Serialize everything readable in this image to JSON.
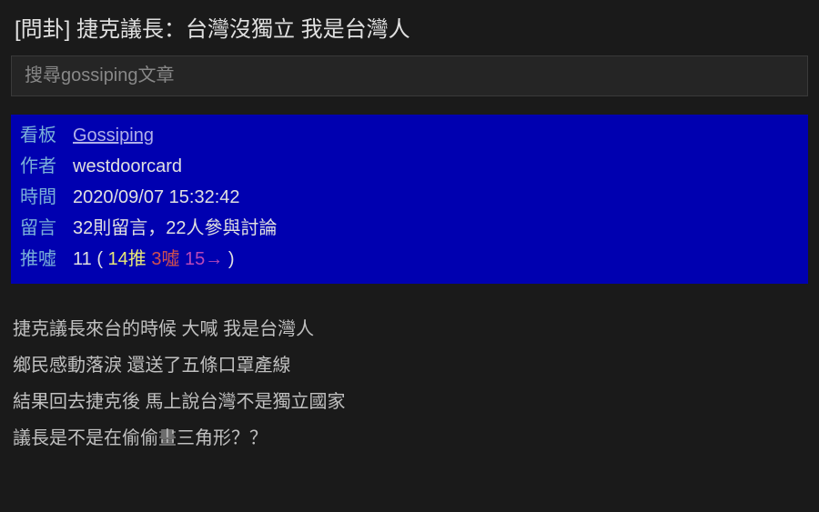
{
  "header": {
    "title": "[問卦] 捷克議長：台灣沒獨立 我是台灣人"
  },
  "search": {
    "placeholder": "搜尋gossiping文章"
  },
  "meta": {
    "board_label": "看板",
    "board_value": "Gossiping",
    "author_label": "作者",
    "author_value": "westdoorcard",
    "time_label": "時間",
    "time_value": "2020/09/07 15:32:42",
    "comments_label": "留言",
    "comments_value": "32則留言，22人參與討論",
    "pushboo_label": "推噓",
    "pushboo_net": "11",
    "pushboo_open": " ( ",
    "push_count": "14推",
    "boo_count": "3噓",
    "arrow_count": "15→",
    "pushboo_close": " )"
  },
  "content": {
    "lines": [
      "捷克議長來台的時候 大喊 我是台灣人",
      "鄉民感動落淚 還送了五條口罩產線",
      "結果回去捷克後 馬上說台灣不是獨立國家",
      "議長是不是在偷偷畫三角形？？"
    ]
  }
}
